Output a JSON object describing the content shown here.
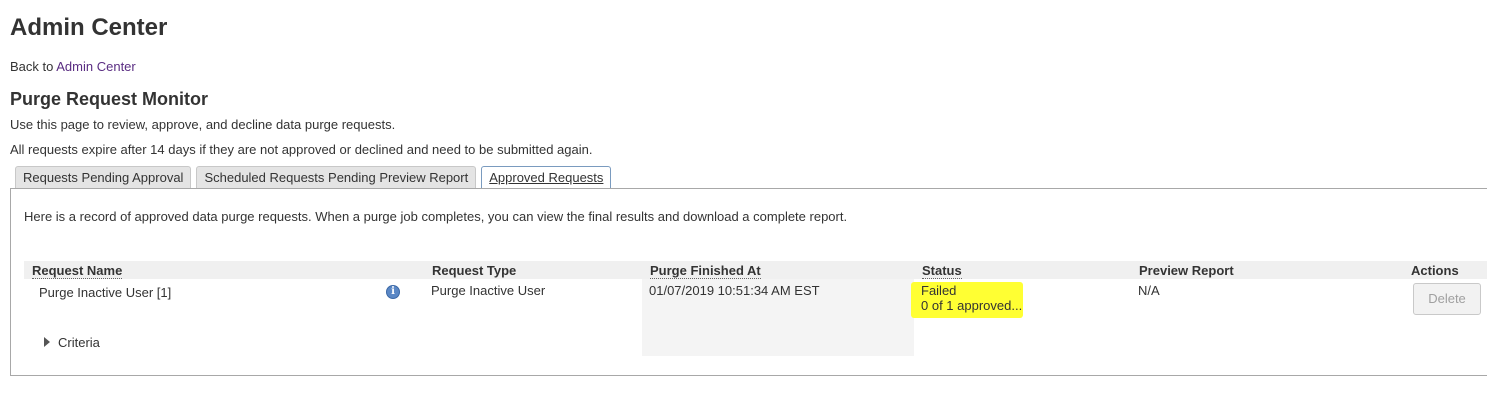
{
  "header": {
    "title": "Admin Center",
    "back_prefix": "Back to",
    "back_link": "Admin Center"
  },
  "section": {
    "title": "Purge Request Monitor",
    "description": "Use this page to review, approve, and decline data purge requests.",
    "expiry_note": "All requests expire after 14 days if they are not approved or declined and need to be submitted again."
  },
  "tabs": [
    {
      "label": "Requests Pending Approval",
      "active": false
    },
    {
      "label": "Scheduled Requests Pending Preview Report",
      "active": false
    },
    {
      "label": "Approved Requests",
      "active": true
    }
  ],
  "panel": {
    "intro": "Here is a record of approved data purge requests. When a purge job completes, you can view the final results and download a complete report."
  },
  "table": {
    "columns": [
      "Request Name",
      "Request Type",
      "Purge Finished At",
      "Status",
      "Preview Report",
      "Actions"
    ],
    "row": {
      "name": "Purge Inactive User [1]",
      "type": "Purge Inactive User",
      "finished_at": "01/07/2019 10:51:34 AM EST",
      "status": "Failed",
      "status_detail": "0 of 1 approved...",
      "preview_report": "N/A",
      "action": "Delete",
      "criteria_label": "Criteria"
    }
  },
  "colors": {
    "link": "#5a2d82",
    "highlight": "#ffff33",
    "tab_active_border": "#7a9bbf"
  },
  "icons": [
    "info-icon",
    "caret-right-icon"
  ]
}
